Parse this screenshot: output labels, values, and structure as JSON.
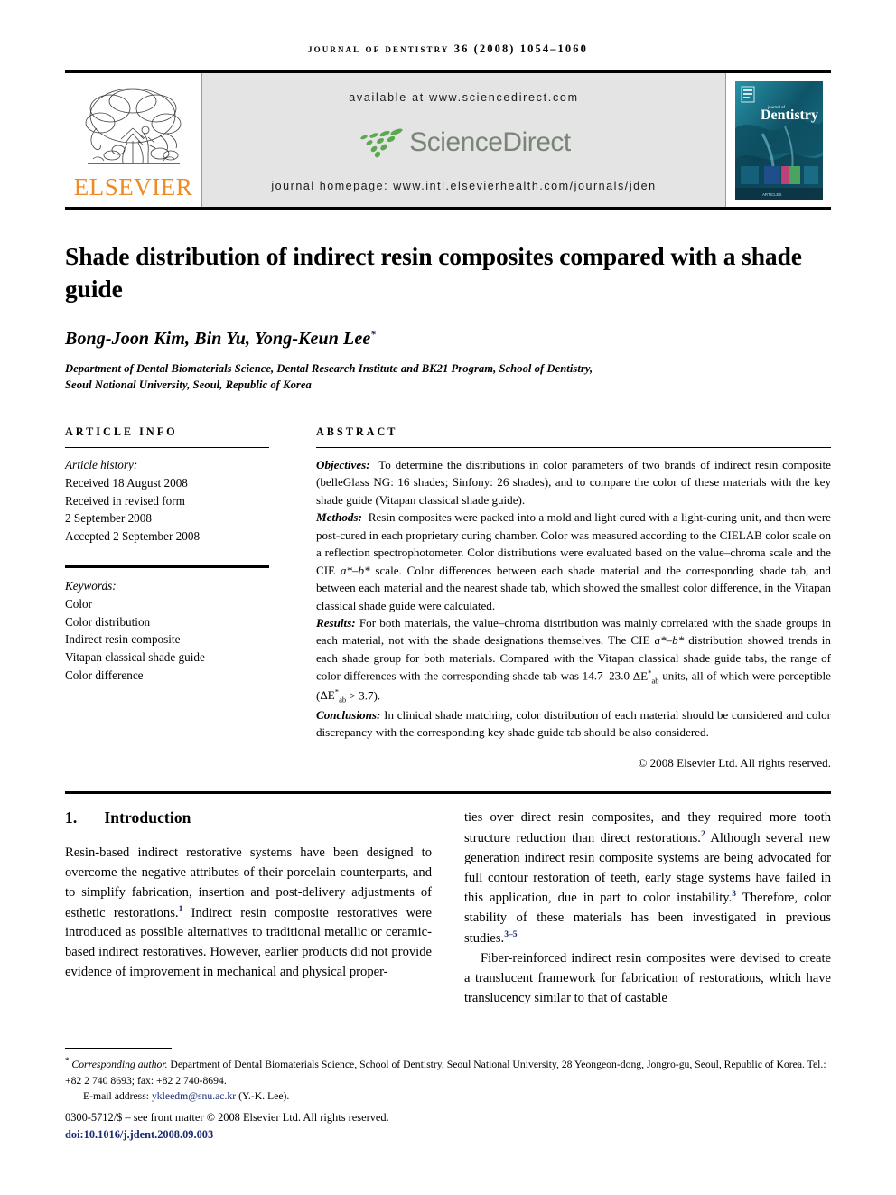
{
  "running_head": "JOURNAL OF DENTISTRY 36 (2008) 1054–1060",
  "masthead": {
    "publisher_name": "ELSEVIER",
    "available_at": "available at www.sciencedirect.com",
    "logo_text": "ScienceDirect",
    "homepage": "journal homepage: www.intl.elsevierhealth.com/journals/jden",
    "cover_title": "Dentistry",
    "cover_supertitle": "journal of",
    "colors": {
      "elsevier_orange": "#f08a22",
      "sciencedirect_green": "#5aa84f",
      "sciencedirect_gray": "#7a8478",
      "banner_gray": "#e4e4e4",
      "cover_teal": "#19667d"
    }
  },
  "article": {
    "title": "Shade distribution of indirect resin composites compared with a shade guide",
    "authors": "Bong-Joon Kim, Bin Yu, Yong-Keun Lee",
    "author_marker": "*",
    "affiliation_line1": "Department of Dental Biomaterials Science, Dental Research Institute and BK21 Program, School of Dentistry,",
    "affiliation_line2": "Seoul National University, Seoul, Republic of Korea"
  },
  "article_info": {
    "heading": "ARTICLE INFO",
    "history_label": "Article history:",
    "history": [
      "Received 18 August 2008",
      "Received in revised form",
      "2 September 2008",
      "Accepted 2 September 2008"
    ],
    "keywords_label": "Keywords:",
    "keywords": [
      "Color",
      "Color distribution",
      "Indirect resin composite",
      "Vitapan classical shade guide",
      "Color difference"
    ]
  },
  "abstract": {
    "heading": "ABSTRACT",
    "objectives_label": "Objectives:",
    "objectives_text": "To determine the distributions in color parameters of two brands of indirect resin composite (belleGlass NG: 16 shades; Sinfony: 26 shades), and to compare the color of these materials with the key shade guide (Vitapan classical shade guide).",
    "methods_label": "Methods:",
    "methods_text_1": "Resin composites were packed into a mold and light cured with a light-curing unit, and then were post-cured in each proprietary curing chamber. Color was measured according to the CIELAB color scale on a reflection spectrophotometer. Color distributions were evaluated based on the value–chroma scale and the CIE ",
    "methods_ab_scale": "a*–b*",
    "methods_text_2": " scale. Color differences between each shade material and the corresponding shade tab, and between each material and the nearest shade tab, which showed the smallest color difference, in the Vitapan classical shade guide were calculated.",
    "results_label": "Results:",
    "results_text_1": "For both materials, the value–chroma distribution was mainly correlated with the shade groups in each material, not with the shade designations themselves. The CIE ",
    "results_ab_scale": "a*–b*",
    "results_text_2": " distribution showed trends in each shade group for both materials. Compared with the Vitapan classical shade guide tabs, the range of color differences with the corresponding shade tab was 14.7–23.0 ",
    "results_delta_symbol": "ΔE",
    "results_delta_sup": "*",
    "results_delta_sub": "ab",
    "results_text_3": " units, all of which were perceptible (",
    "results_text_4": " > 3.7).",
    "conclusions_label": "Conclusions:",
    "conclusions_text": "In clinical shade matching, color distribution of each material should be considered and color discrepancy with the corresponding key shade guide tab should be also considered.",
    "copyright": "© 2008 Elsevier Ltd. All rights reserved."
  },
  "body": {
    "section_number": "1.",
    "section_title": "Introduction",
    "left_para_1a": "Resin-based indirect restorative systems have been designed to overcome the negative attributes of their porcelain counterparts, and to simplify fabrication, insertion and post-delivery adjustments of esthetic restorations.",
    "left_ref_1": "1",
    "left_para_1b": " Indirect resin composite restoratives were introduced as possible alternatives to traditional metallic or ceramic-based indirect restoratives. However, earlier products did not provide evidence of improvement in mechanical and physical proper-",
    "right_para_1a": "ties over direct resin composites, and they required more tooth structure reduction than direct restorations.",
    "right_ref_2": "2",
    "right_para_1b": " Although several new generation indirect resin composite systems are being advocated for full contour restoration of teeth, early stage systems have failed in this application, due in part to color instability.",
    "right_ref_3": "3",
    "right_para_1c": " Therefore, color stability of these materials has been investigated in previous studies.",
    "right_ref_35": "3–5",
    "right_para_2a": "Fiber-reinforced indirect resin composites were devised to create a translucent framework for fabrication of restorations, which have translucency similar to that of castable"
  },
  "footnotes": {
    "corresponding_marker": "*",
    "corresponding_label": "Corresponding author.",
    "corresponding_text": " Department of Dental Biomaterials Science, School of Dentistry, Seoul National University, 28 Yeongeon-dong, Jongro-gu, Seoul, Republic of Korea. Tel.: +82 2 740 8693; fax: +82 2 740-8694.",
    "email_label": "E-mail address:",
    "email": "ykleedm@snu.ac.kr",
    "email_suffix": "(Y.-K. Lee).",
    "front_matter": "0300-5712/$ – see front matter © 2008 Elsevier Ltd. All rights reserved.",
    "doi_prefix": "doi:",
    "doi": "10.1016/j.jdent.2008.09.003"
  }
}
